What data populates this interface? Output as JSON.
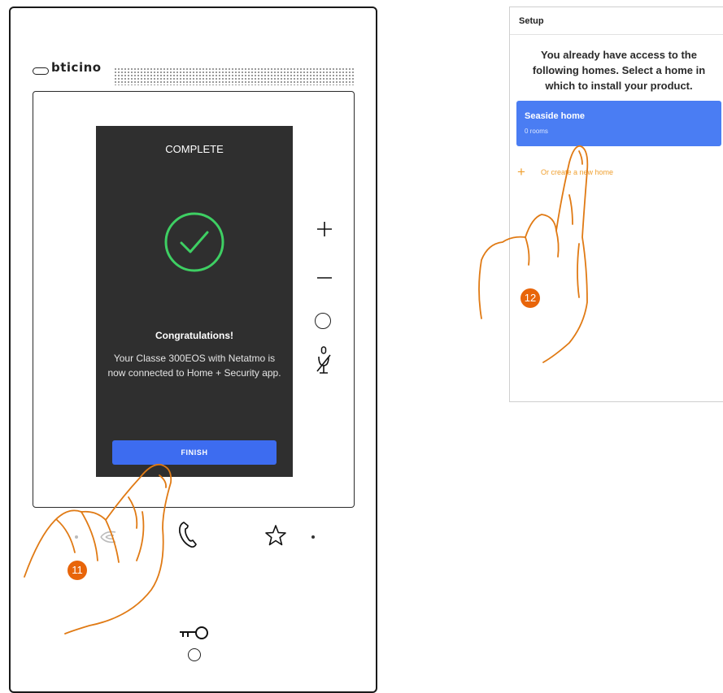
{
  "device": {
    "brand": "bticino",
    "screen": {
      "title": "COMPLETE",
      "heading": "Congratulations!",
      "body": "Your Classe 300EOS with Netatmo is now connected to Home + Security app.",
      "finish_label": "FINISH",
      "accent_color": "#3d6cf0",
      "success_color": "#3ecf63"
    },
    "side_keys": {
      "plus": "+",
      "minus": "—"
    }
  },
  "app": {
    "header": "Setup",
    "intro": "You already have access to the following homes. Select a home in which to install your product.",
    "home_card": {
      "name": "Seaside home",
      "rooms": "0 rooms"
    },
    "create_plus": "+",
    "create_label": "Or create a new home",
    "accent_color": "#4a7df3",
    "link_color": "#f0a030"
  },
  "steps": [
    "11",
    "12"
  ],
  "badge_color": "#e8650a"
}
